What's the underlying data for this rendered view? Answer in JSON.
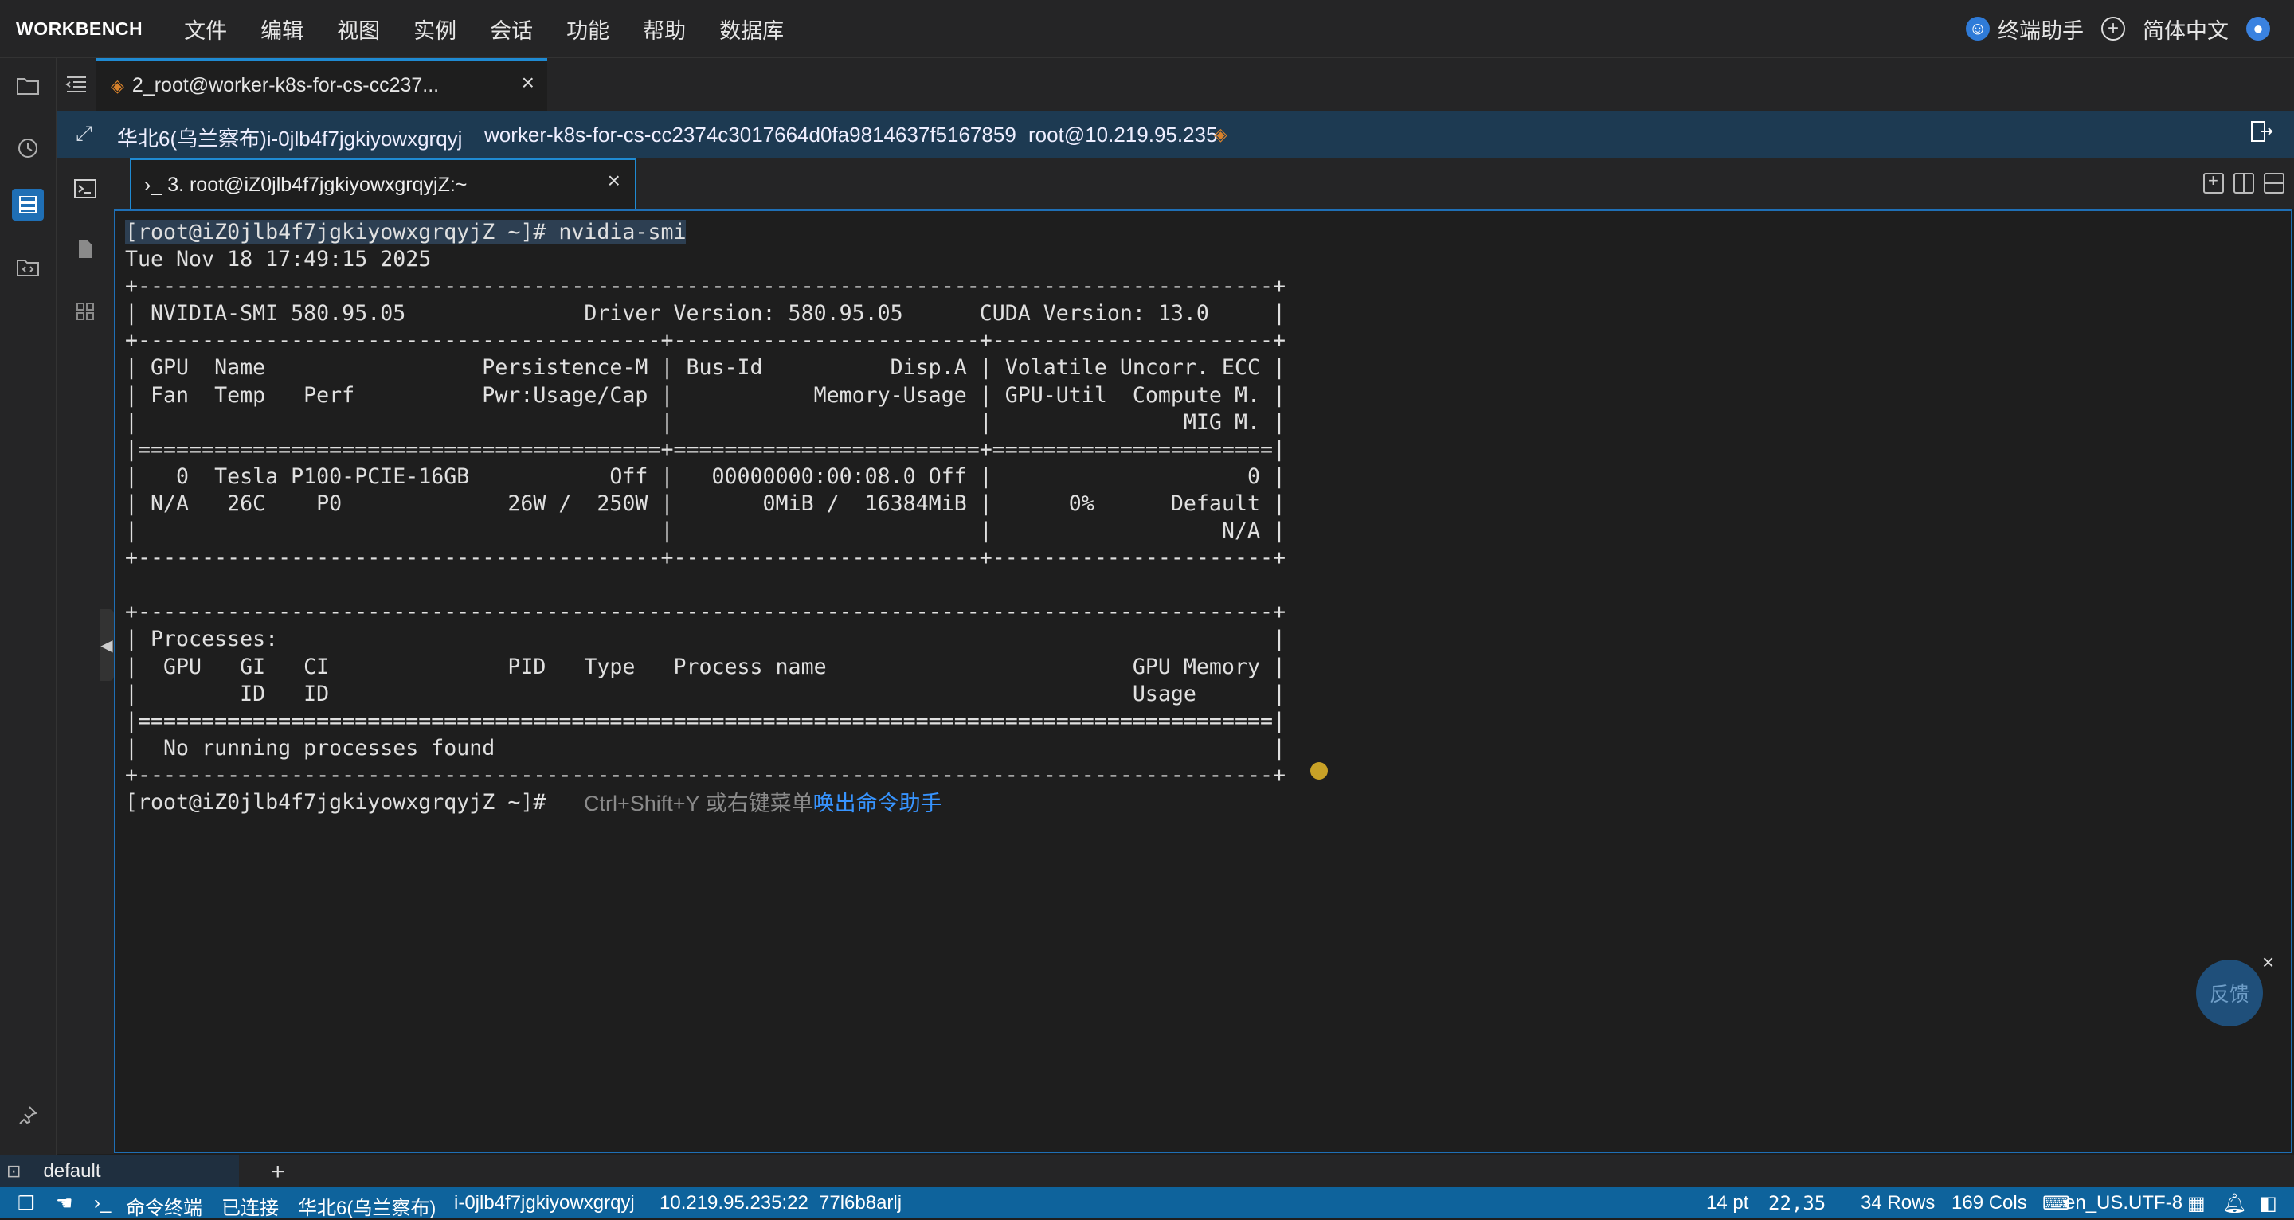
{
  "app": {
    "brand": "WORKBENCH",
    "menu": [
      "文件",
      "编辑",
      "视图",
      "实例",
      "会话",
      "功能",
      "帮助",
      "数据库"
    ],
    "assistant_label": "终端助手",
    "language_label": "简体中文"
  },
  "session_tab": {
    "label": "2_root@worker-k8s-for-cs-cc237..."
  },
  "infobar": {
    "region_instance": "华北6(乌兰察布)i-0jlb4f7jgkiyowxgrqyj",
    "hostname": "worker-k8s-for-cs-cc2374c3017664d0fa9814637f5167859",
    "user_ip": "root@10.219.95.235"
  },
  "terminal_tab": {
    "label": "3. root@iZ0jlb4f7jgkiyowxgrqyjZ:~"
  },
  "terminal": {
    "prompt": "[root@iZ0jlb4f7jgkiyowxgrqyjZ ~]#",
    "command": " nvidia-smi",
    "output": [
      "Tue Nov 18 17:49:15 2025",
      "+-----------------------------------------------------------------------------------------+",
      "| NVIDIA-SMI 580.95.05              Driver Version: 580.95.05      CUDA Version: 13.0     |",
      "+-----------------------------------------+------------------------+----------------------+",
      "| GPU  Name                 Persistence-M | Bus-Id          Disp.A | Volatile Uncorr. ECC |",
      "| Fan  Temp   Perf          Pwr:Usage/Cap |           Memory-Usage | GPU-Util  Compute M. |",
      "|                                         |                        |               MIG M. |",
      "|=========================================+========================+======================|",
      "|   0  Tesla P100-PCIE-16GB           Off |   00000000:00:08.0 Off |                    0 |",
      "| N/A   26C    P0             26W /  250W |       0MiB /  16384MiB |      0%      Default |",
      "|                                         |                        |                  N/A |",
      "+-----------------------------------------+------------------------+----------------------+",
      "",
      "+-----------------------------------------------------------------------------------------+",
      "| Processes:                                                                              |",
      "|  GPU   GI   CI              PID   Type   Process name                        GPU Memory |",
      "|        ID   ID                                                               Usage      |",
      "|=========================================================================================|",
      "|  No running processes found                                                             |",
      "+-----------------------------------------------------------------------------------------+"
    ],
    "final_prompt": "[root@iZ0jlb4f7jgkiyowxgrqyjZ ~]#",
    "hint_text": "Ctrl+Shift+Y 或右键菜单",
    "hint_link": "唤出命令助手"
  },
  "feedback_label": "反馈",
  "panel": {
    "tab_label": "default"
  },
  "statusbar": {
    "mode": "命令终端",
    "connection": "已连接",
    "region": "华北6(乌兰察布)",
    "instance": "i-0jlb4f7jgkiyowxgrqyj",
    "address": "10.219.95.235:22",
    "session_id": "77l6b8arlj",
    "font_size": "14 pt",
    "cursor": "22,35",
    "rows": "34 Rows",
    "cols": "169 Cols",
    "locale": "en_US.UTF-8"
  },
  "colors": {
    "accent": "#1f8ad2",
    "statusbar": "#0e639c",
    "infobar": "#1d3a52",
    "hint_link": "#3794ff"
  }
}
